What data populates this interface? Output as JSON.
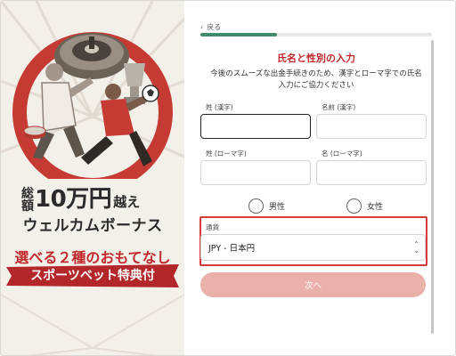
{
  "promo": {
    "line1_small": "総額",
    "line1_big": "10万円",
    "line1_suffix": "越え",
    "line2": "ウェルカムボーナス",
    "line3": "選べる２種のおもてなし",
    "ribbon": "スポーツベット特典付",
    "colors": {
      "accent_red": "#c0282c",
      "ribbon_red": "#b3262a"
    }
  },
  "form": {
    "back_label": "戻る",
    "progress_fraction": 0.33,
    "title": "氏名と性別の入力",
    "description_line1": "今後のスムーズな出金手続きのため、漢字とローマ字での氏名",
    "description_line2": "入力にご協力ください",
    "fields": {
      "last_kanji": {
        "label": "姓 (漢字)",
        "value": ""
      },
      "first_kanji": {
        "label": "名前 (漢字)",
        "value": ""
      },
      "last_roman": {
        "label": "姓 (ローマ字)",
        "value": ""
      },
      "first_roman": {
        "label": "名 (ローマ字)",
        "value": ""
      }
    },
    "gender": {
      "male": "男性",
      "female": "女性"
    },
    "currency": {
      "label": "通貨",
      "selected": "JPY - 日本円"
    },
    "next_label": "次へ",
    "colors": {
      "progress": "#3f8c6c",
      "title": "#c0282c",
      "highlight": "#d83a3a",
      "next_button": "#e9b1a9"
    }
  }
}
